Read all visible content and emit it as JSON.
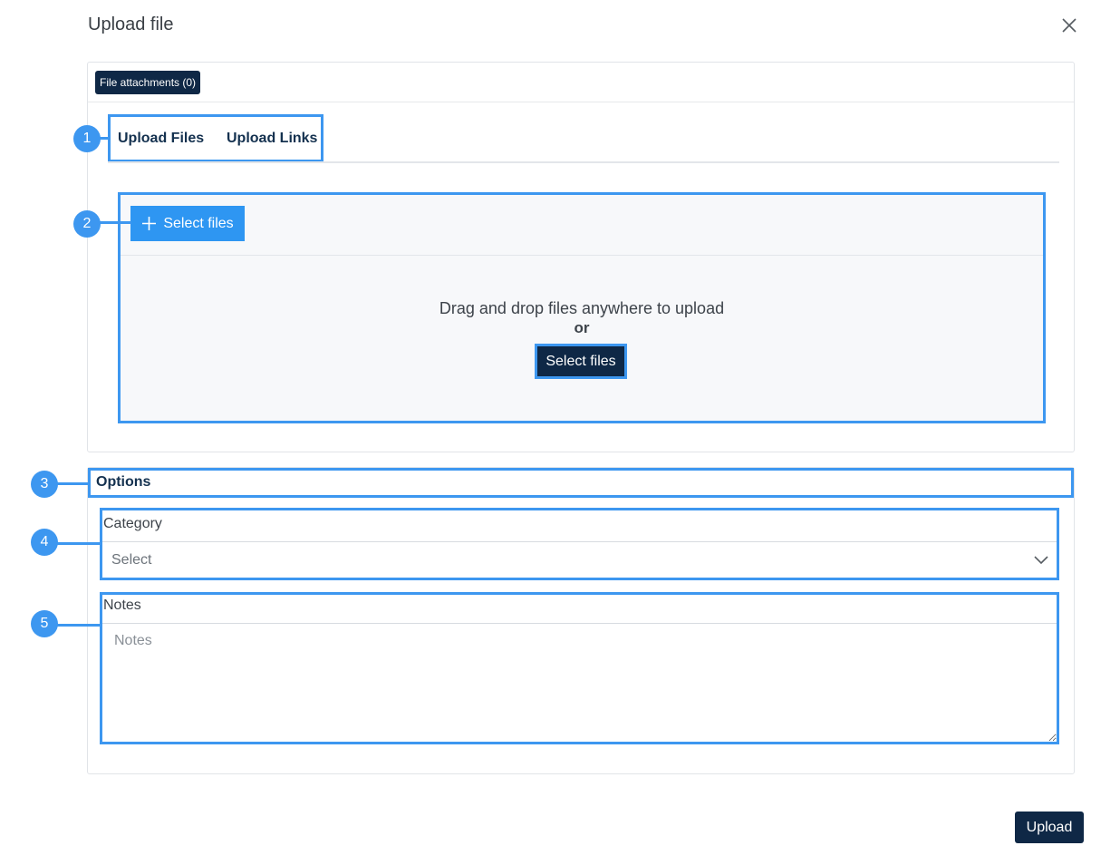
{
  "modal": {
    "title": "Upload file",
    "close_icon": "close-icon"
  },
  "attachments": {
    "badge_label": "File attachments (0)"
  },
  "tabs": [
    {
      "label": "Upload Files"
    },
    {
      "label": "Upload Links"
    }
  ],
  "dropzone": {
    "select_files_label": "Select files",
    "drag_text": "Drag and drop files anywhere to upload",
    "or_text": "or",
    "select_files_center_label": "Select files"
  },
  "options": {
    "title": "Options",
    "category": {
      "label": "Category",
      "value": "Select"
    },
    "notes": {
      "label": "Notes",
      "placeholder": "Notes"
    }
  },
  "footer": {
    "upload_label": "Upload"
  },
  "callouts": [
    "1",
    "2",
    "3",
    "4",
    "5"
  ],
  "colors": {
    "accent_blue": "#3d97f0",
    "navy": "#0f2846",
    "button_blue": "#2e96f2"
  }
}
